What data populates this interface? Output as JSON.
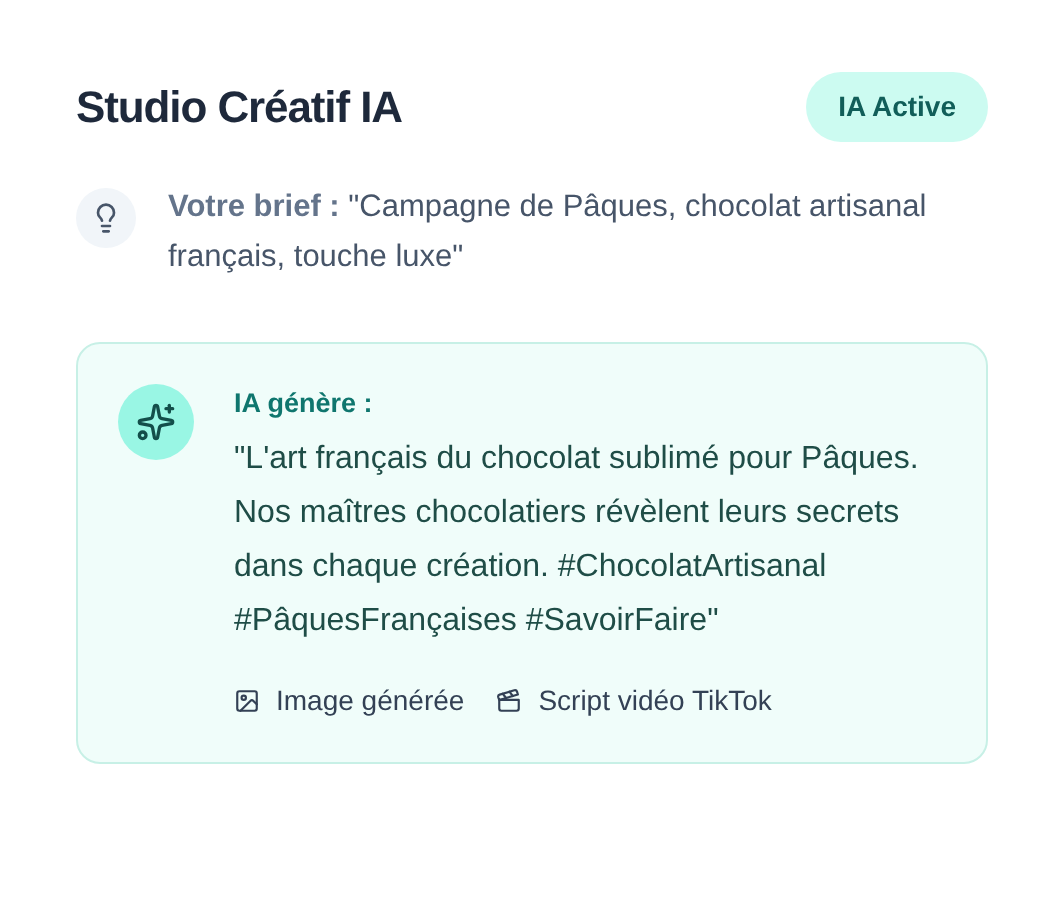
{
  "header": {
    "title": "Studio Créatif IA",
    "badge": "IA Active"
  },
  "brief": {
    "text": "**Votre brief :** \"Campagne de Pâques, chocolat artisanal français, touche luxe\""
  },
  "result": {
    "label": "IA génère :",
    "text": "\"L'art français du chocolat sublimé pour Pâques. Nos maîtres chocolatiers révèlent leurs secrets dans chaque création. #ChocolatArtisanal #PâquesFrançaises #SavoirFaire\"",
    "outputs": [
      {
        "kind": "image",
        "label": "Image générée"
      },
      {
        "kind": "video",
        "label": "Script vidéo TikTok"
      }
    ]
  }
}
